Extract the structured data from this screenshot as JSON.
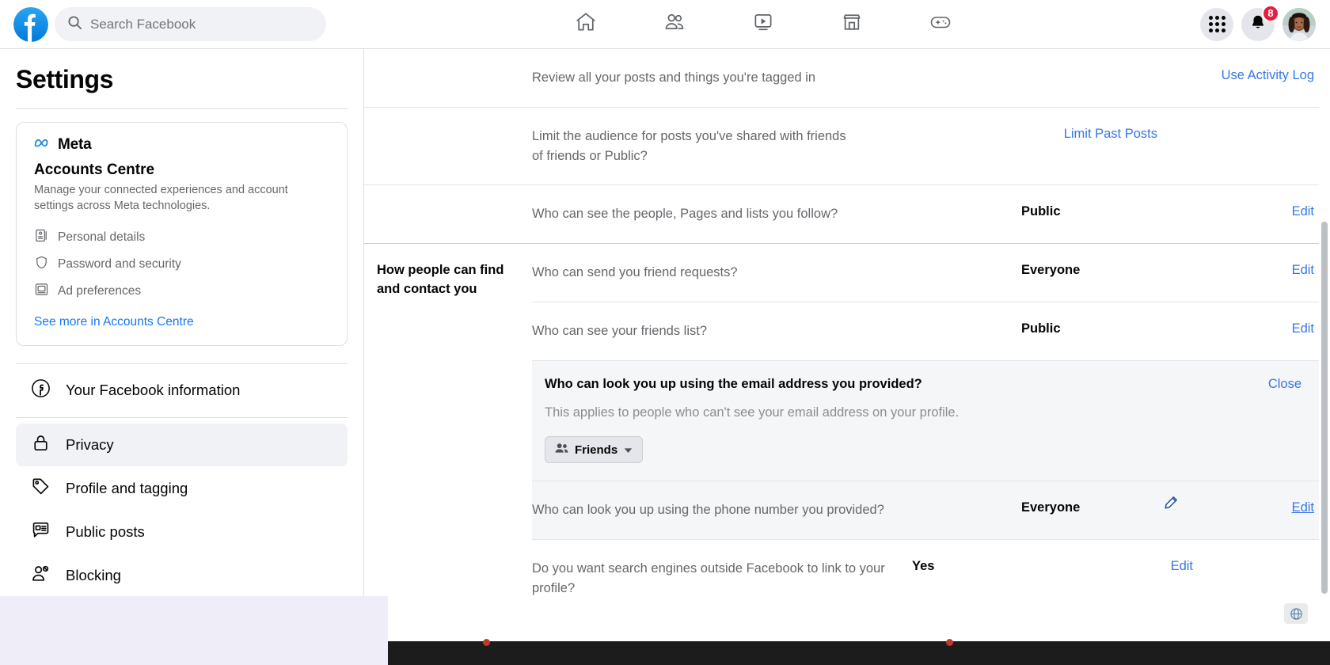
{
  "header": {
    "logo_icon": "facebook-logo-icon",
    "search": {
      "placeholder": "Search Facebook",
      "value": "",
      "icon": "search-icon"
    },
    "nav": [
      {
        "name": "home",
        "icon": "home-icon",
        "label": "Home"
      },
      {
        "name": "friends",
        "icon": "friends-icon",
        "label": "Friends"
      },
      {
        "name": "video",
        "icon": "video-icon",
        "label": "Video"
      },
      {
        "name": "marketplace",
        "icon": "marketplace-icon",
        "label": "Marketplace"
      },
      {
        "name": "gaming",
        "icon": "gaming-icon",
        "label": "Gaming"
      }
    ],
    "menu_icon": "grid-menu-icon",
    "notifications": {
      "icon": "bell-icon",
      "badge": "8"
    },
    "avatar_icon": "user-avatar"
  },
  "sidebar": {
    "title": "Settings",
    "accounts_centre": {
      "brand": "Meta",
      "brand_icon": "meta-infinity-icon",
      "title": "Accounts Centre",
      "description": "Manage your connected experiences and account settings across Meta technologies.",
      "items": [
        {
          "label": "Personal details",
          "icon": "id-card-icon"
        },
        {
          "label": "Password and security",
          "icon": "shield-icon"
        },
        {
          "label": "Ad preferences",
          "icon": "monitor-icon"
        }
      ],
      "link": "See more in Accounts Centre"
    },
    "nav_items": [
      {
        "label": "Your Facebook information",
        "icon": "facebook-circle-icon",
        "active": false
      },
      {
        "label": "Privacy",
        "icon": "lock-icon",
        "active": true
      },
      {
        "label": "Profile and tagging",
        "icon": "tag-icon",
        "active": false
      },
      {
        "label": "Public posts",
        "icon": "speech-bubble-icon",
        "active": false
      },
      {
        "label": "Blocking",
        "icon": "user-block-icon",
        "active": false
      }
    ]
  },
  "main": {
    "top_rows": [
      {
        "question": "Review all your posts and things you're tagged in",
        "value": "",
        "action": "Use Activity Log"
      },
      {
        "question": "Limit the audience for posts you've shared with friends of friends or Public?",
        "value": "",
        "action": "Limit Past Posts"
      },
      {
        "question": "Who can see the people, Pages and lists you follow?",
        "value": "Public",
        "action": "Edit"
      }
    ],
    "section": {
      "heading": "How people can find and contact you",
      "rows": [
        {
          "question": "Who can send you friend requests?",
          "value": "Everyone",
          "action": "Edit",
          "state": "normal"
        },
        {
          "question": "Who can see your friends list?",
          "value": "Public",
          "action": "Edit",
          "state": "normal"
        }
      ],
      "expanded_row": {
        "question": "Who can look you up using the email address you provided?",
        "description": "This applies to people who can't see your email address on your profile.",
        "close_label": "Close",
        "audience_value": "Friends",
        "audience_icon": "friends-pair-icon",
        "chevron_icon": "chevron-down-icon"
      },
      "rows_after": [
        {
          "question": "Who can look you up using the phone number you provided?",
          "value": "Everyone",
          "action": "Edit",
          "state": "hovered"
        },
        {
          "question": "Do you want search engines outside Facebook to link to your profile?",
          "value": "Yes",
          "action": "Edit",
          "state": "normal"
        }
      ]
    },
    "cursor_icon": "pencil-cursor-icon"
  },
  "overlays": {
    "globe_icon": "globe-icon"
  },
  "colors": {
    "accent": "#1877f2",
    "link": "#3578e5",
    "badge": "#e41e3f",
    "panel_bg": "#f5f6f7",
    "active_nav": "#f0f2f5"
  }
}
